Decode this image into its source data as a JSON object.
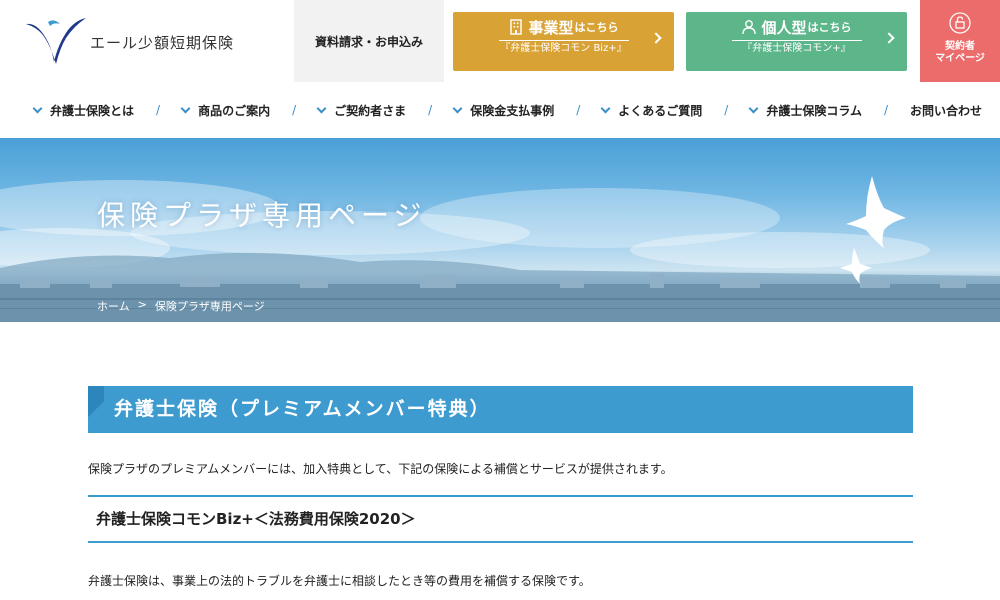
{
  "header": {
    "logo_text": "エール少額短期保険",
    "request_label": "資料請求・お申込み",
    "cta_business": {
      "big": "事業型",
      "small": "はこちら",
      "sub": "『弁護士保険コモン Biz+』"
    },
    "cta_individual": {
      "big": "個人型",
      "small": "はこちら",
      "sub": "『弁護士保険コモン+』"
    },
    "mypage": {
      "line1": "契約者",
      "line2": "マイページ"
    }
  },
  "nav": {
    "items": [
      "弁護士保険とは",
      "商品のご案内",
      "ご契約者さま",
      "保険金支払事例",
      "よくあるご質問",
      "弁護士保険コラム",
      "お問い合わせ"
    ]
  },
  "hero": {
    "title": "保険プラザ専用ページ",
    "breadcrumb": [
      "ホーム",
      ">",
      "保険プラザ専用ページ"
    ]
  },
  "content": {
    "section_title": "弁護士保険（プレミアムメンバー特典）",
    "intro": "保険プラザのプレミアムメンバーには、加入特典として、下記の保険による補償とサービスが提供されます。",
    "product_title": "弁護士保険コモンBiz+＜法務費用保険2020＞",
    "product_desc": "弁護士保険は、事業上の法的トラブルを弁護士に相談したとき等の費用を補償する保険です。"
  },
  "colors": {
    "accent_blue": "#3d9bd0",
    "cta_business": "#d9a235",
    "cta_individual": "#5db58a",
    "mypage": "#ec6b6b"
  }
}
